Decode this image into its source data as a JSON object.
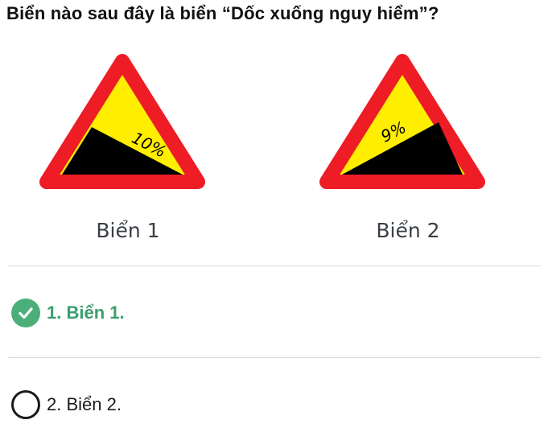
{
  "question": {
    "text": "Biển nào sau đây là biển “Dốc xuống nguy hiểm”?"
  },
  "signs": [
    {
      "caption": "Biển 1",
      "grade_label": "10%",
      "icon": "steep-descent-warning-sign"
    },
    {
      "caption": "Biển 2",
      "grade_label": "9%",
      "icon": "steep-ascent-warning-sign"
    }
  ],
  "options": [
    {
      "label": "1. Biển 1.",
      "selected": true,
      "correct": true,
      "icon": "checkmark-icon"
    },
    {
      "label": "2. Biển 2.",
      "selected": false,
      "correct": false,
      "icon": "radio-empty-icon"
    }
  ],
  "colors": {
    "sign_border": "#ee1c25",
    "sign_fill": "#ffee00",
    "sign_slope": "#000000",
    "correct_green": "#3a9e6f",
    "check_bg": "#4caf7a",
    "divider": "#d9d9d9"
  }
}
